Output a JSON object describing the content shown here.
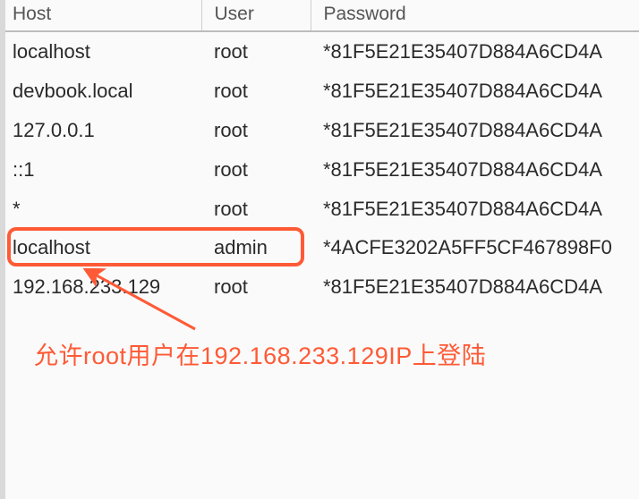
{
  "headers": {
    "host": "Host",
    "user": "User",
    "password": "Password"
  },
  "rows": [
    {
      "host": "localhost",
      "user": "root",
      "password": "*81F5E21E35407D884A6CD4A"
    },
    {
      "host": "devbook.local",
      "user": "root",
      "password": "*81F5E21E35407D884A6CD4A"
    },
    {
      "host": "127.0.0.1",
      "user": "root",
      "password": "*81F5E21E35407D884A6CD4A"
    },
    {
      "host": "::1",
      "user": "root",
      "password": "*81F5E21E35407D884A6CD4A"
    },
    {
      "host": "*",
      "user": "root",
      "password": "*81F5E21E35407D884A6CD4A"
    },
    {
      "host": "localhost",
      "user": "admin",
      "password": "*4ACFE3202A5FF5CF467898F0"
    },
    {
      "host": "192.168.233.129",
      "user": "root",
      "password": "*81F5E21E35407D884A6CD4A"
    }
  ],
  "annotation_text": "允许root用户在192.168.233.129IP上登陆",
  "highlight_color": "#ff5a36"
}
